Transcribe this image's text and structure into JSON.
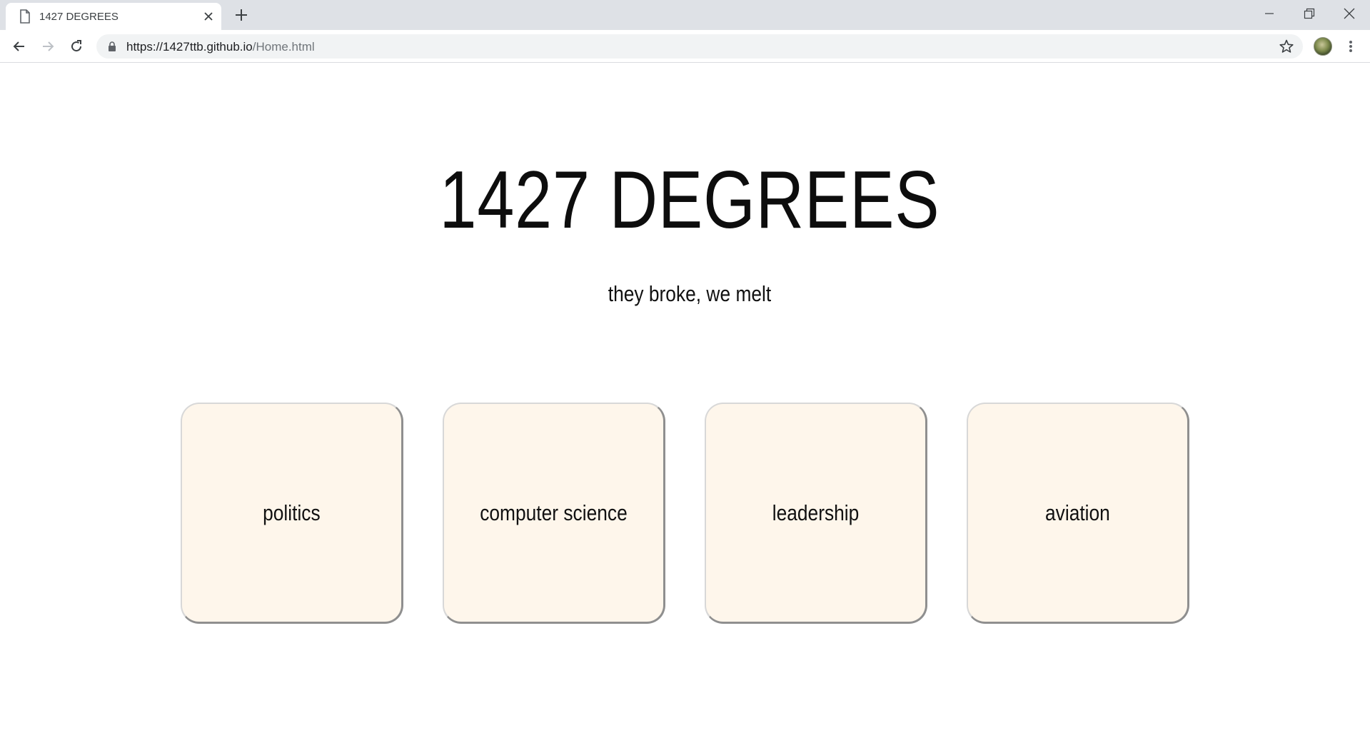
{
  "browser": {
    "tab_title": "1427 DEGREES",
    "url_host": "https://1427ttb.github.io",
    "url_path": "/Home.html"
  },
  "page": {
    "title": "1427 DEGREES",
    "tagline": "they broke, we melt",
    "cards": [
      {
        "label": "politics"
      },
      {
        "label": "computer science"
      },
      {
        "label": "leadership"
      },
      {
        "label": "aviation"
      }
    ]
  },
  "colors": {
    "card_background": "#fef6eb",
    "tabstrip": "#dee1e6",
    "omnibox": "#f1f3f4"
  }
}
